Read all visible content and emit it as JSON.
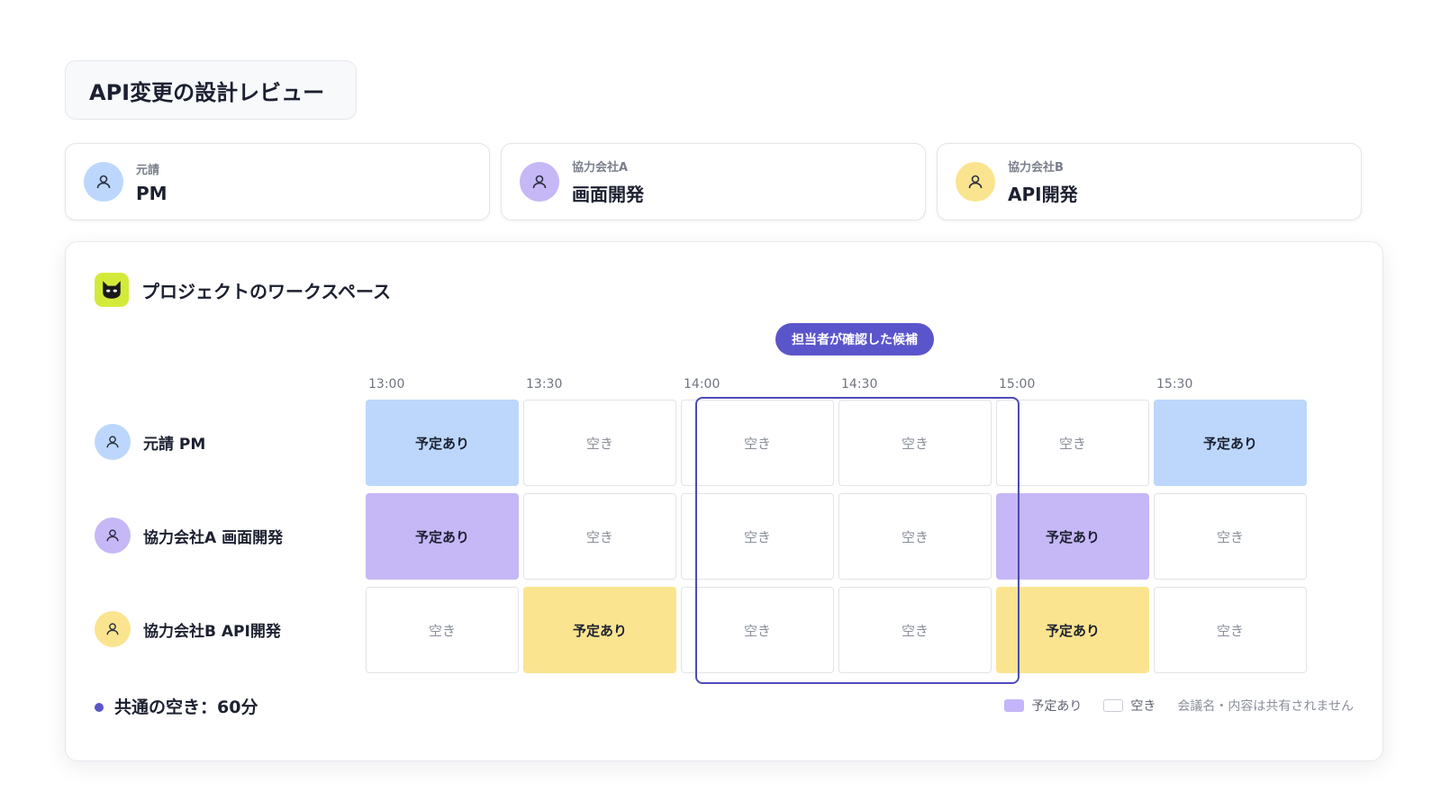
{
  "title": "API変更の設計レビュー",
  "parties": [
    {
      "org": "元請",
      "role": "PM",
      "avatar_color": "#bcd7fb",
      "icon": "person-icon"
    },
    {
      "org": "協力会社A",
      "role": "画面開発",
      "avatar_color": "#c6b7f6",
      "icon": "person-icon"
    },
    {
      "org": "協力会社B",
      "role": "API開発",
      "avatar_color": "#fbe48f",
      "icon": "person-icon"
    }
  ],
  "workspace": {
    "title": "プロジェクトのワークスペース",
    "app_icon": "cat-mask-icon",
    "app_icon_color": "#d4ea3a",
    "candidate_label": "担当者が確認した候補",
    "times": [
      "13:00",
      "13:30",
      "14:00",
      "14:30",
      "15:00",
      "15:30"
    ],
    "rows": [
      {
        "name": "元請 PM",
        "color": "#bcd7fb",
        "cells": [
          "予定あり",
          "空き",
          "空き",
          "空き",
          "空き",
          "予定あり"
        ],
        "busy": [
          true,
          false,
          false,
          false,
          false,
          true
        ]
      },
      {
        "name": "協力会社A 画面開発",
        "color": "#c6b7f6",
        "cells": [
          "予定あり",
          "空き",
          "空き",
          "空き",
          "予定あり",
          "空き"
        ],
        "busy": [
          true,
          false,
          false,
          false,
          true,
          false
        ]
      },
      {
        "name": "協力会社B API開発",
        "color": "#fbe48f",
        "cells": [
          "空き",
          "予定あり",
          "空き",
          "空き",
          "予定あり",
          "空き"
        ],
        "busy": [
          false,
          true,
          false,
          false,
          true,
          false
        ]
      }
    ],
    "highlight_slots": [
      "14:00",
      "14:30"
    ],
    "summary": "共通の空き：60分",
    "legend": {
      "busy": "予定あり",
      "free": "空き",
      "note": "会議名・内容は共有されません"
    },
    "accent_color": "#5b55cc"
  }
}
